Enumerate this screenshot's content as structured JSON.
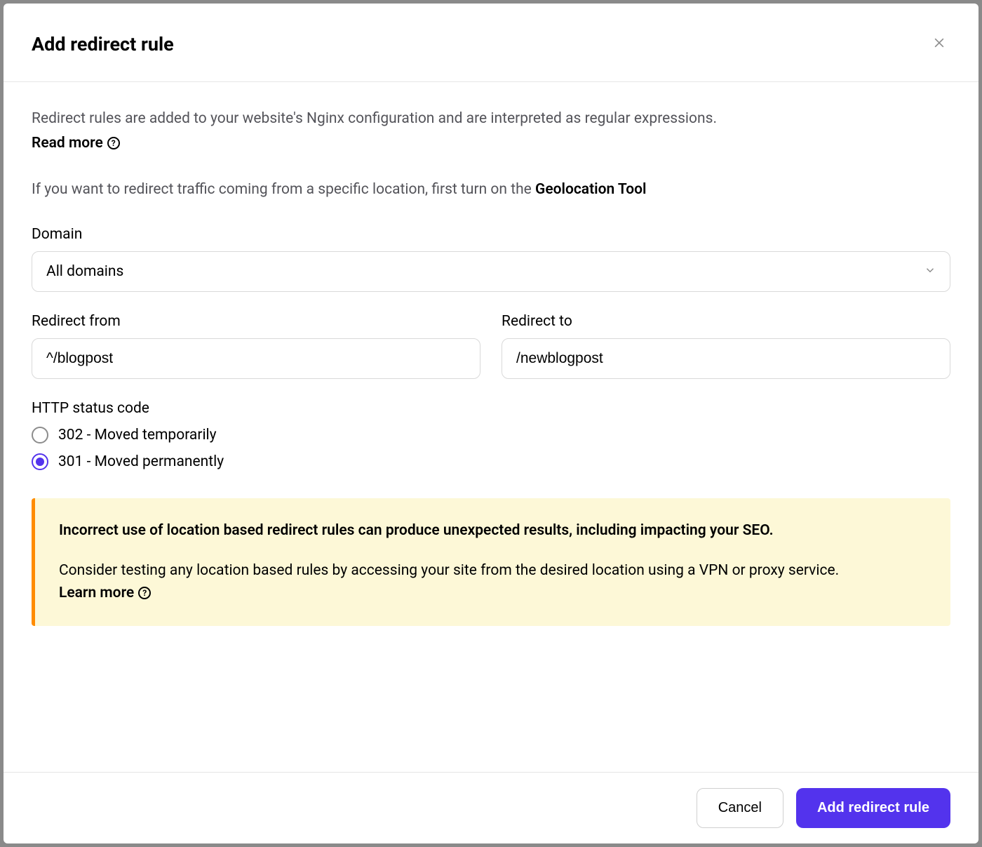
{
  "header": {
    "title": "Add redirect rule"
  },
  "body": {
    "info_text": "Redirect rules are added to your website's Nginx configuration and are interpreted as regular expressions.",
    "read_more": "Read more",
    "geo_text_prefix": "If you want to redirect traffic coming from a specific location, first turn on the ",
    "geo_tool": "Geolocation Tool",
    "domain_label": "Domain",
    "domain_value": "All domains",
    "redirect_from_label": "Redirect from",
    "redirect_from_value": "^/blogpost",
    "redirect_to_label": "Redirect to",
    "redirect_to_value": "/newblogpost",
    "status_code_label": "HTTP status code",
    "radio_302": "302 - Moved temporarily",
    "radio_301": "301 - Moved permanently",
    "warning_title": "Incorrect use of location based redirect rules can produce unexpected results, including impacting your SEO.",
    "warning_body": "Consider testing any location based rules by accessing your site from the desired location using a VPN or proxy service. ",
    "learn_more": "Learn more"
  },
  "footer": {
    "cancel": "Cancel",
    "submit": "Add redirect rule"
  }
}
